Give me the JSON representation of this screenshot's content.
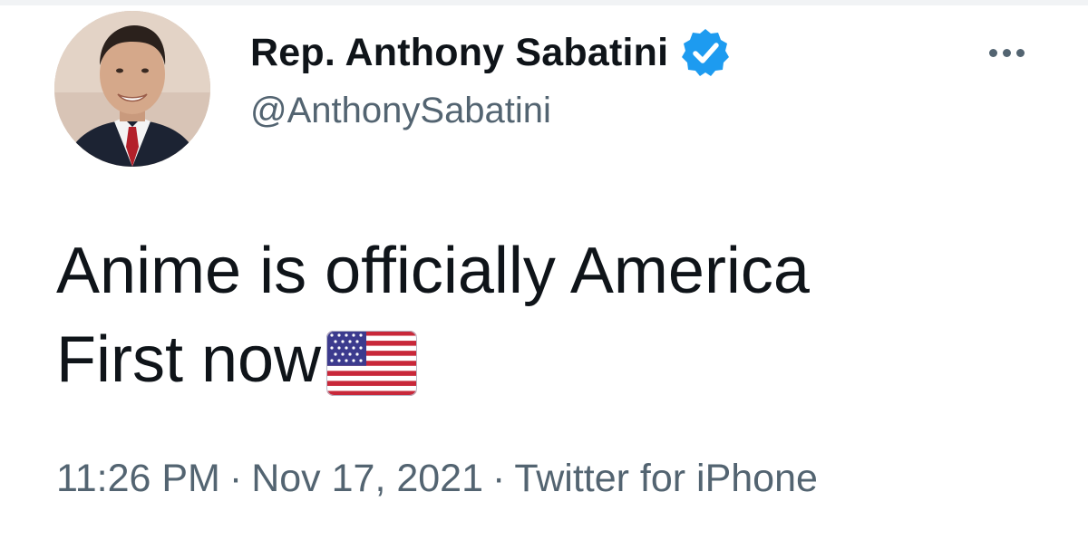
{
  "author": {
    "display_name": "Rep. Anthony Sabatini",
    "handle": "@AnthonySabatini",
    "verified": true,
    "avatar_icon": "profile-photo"
  },
  "tweet": {
    "text": "Anime is officially America\nFirst now",
    "emoji": "us-flag-icon"
  },
  "meta": {
    "time": "11:26 PM",
    "separator": "·",
    "date": "Nov 17, 2021",
    "source": "Twitter for iPhone"
  },
  "colors": {
    "text": "#0f1419",
    "secondary": "#536471",
    "verified": "#1d9bf0"
  }
}
